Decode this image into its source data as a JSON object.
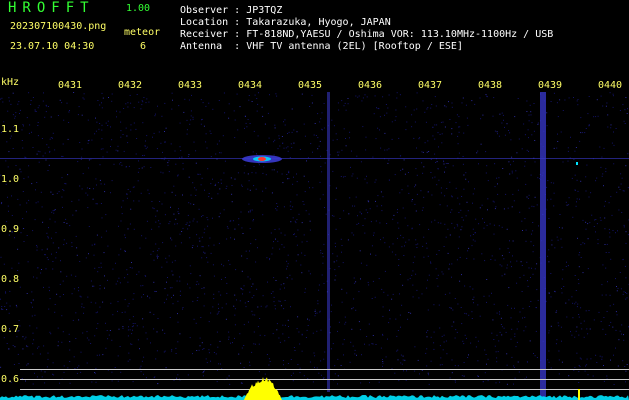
{
  "header": {
    "logo": "HROFFT",
    "version": "1.00",
    "filename": "202307100430.png",
    "datetime": "23.07.10 04:30",
    "meteor_label": "meteor",
    "meteor_count": "6"
  },
  "info": {
    "observer": "Observer : JP3TQZ",
    "location": "Location : Takarazuka, Hyogo, JAPAN",
    "receiver": "Receiver : FT-818ND,YAESU / Oshima VOR: 113.10MHz-1100Hz / USB",
    "antenna": "Antenna  : VHF TV antenna (2EL) [Rooftop / ESE]"
  },
  "axis": {
    "unit": "kHz",
    "y_ticks": [
      "1.1",
      "1.0",
      "0.9",
      "0.8",
      "0.7",
      "0.6"
    ],
    "x_ticks": [
      "0431",
      "0432",
      "0433",
      "0434",
      "0435",
      "0436",
      "0437",
      "0438",
      "0439",
      "0440"
    ]
  },
  "colors": {
    "background": "#000000",
    "label_yellow": "#ffff66",
    "logo_green": "#33ff33",
    "noise_blue": "#1a1a8c",
    "line_blue": "#3a3ad0",
    "spectrum_cyan": "#00e5ff",
    "echo_yellow": "#ffff00"
  }
}
